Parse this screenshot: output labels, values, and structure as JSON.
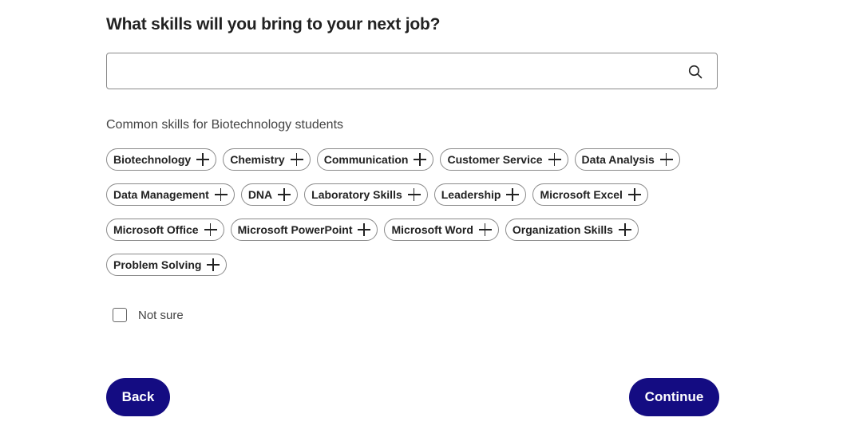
{
  "page": {
    "title": "What skills will you bring to your next job?",
    "subtitle": "Common skills for Biotechnology students"
  },
  "search": {
    "value": "",
    "placeholder": "",
    "icon": "search-icon"
  },
  "skills": [
    [
      "Biotechnology",
      "Chemistry",
      "Communication",
      "Customer Service",
      "Data Analysis"
    ],
    [
      "Data Management",
      "DNA",
      "Laboratory Skills",
      "Leadership",
      "Microsoft Excel"
    ],
    [
      "Microsoft Office",
      "Microsoft PowerPoint",
      "Microsoft Word",
      "Organization Skills"
    ],
    [
      "Problem Solving"
    ]
  ],
  "not_sure": {
    "label": "Not sure",
    "checked": false
  },
  "buttons": {
    "back": "Back",
    "continue": "Continue"
  },
  "colors": {
    "primary": "#140c82",
    "chip_border": "#8a8a8a",
    "text": "#222222"
  }
}
